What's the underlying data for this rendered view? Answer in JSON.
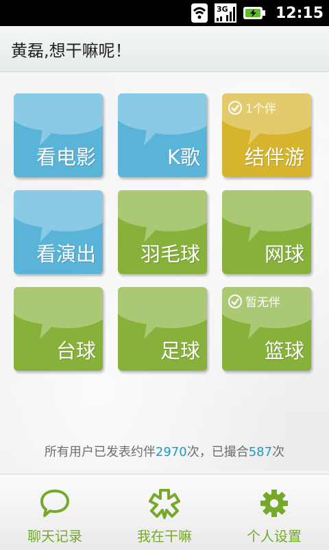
{
  "status_bar": {
    "network": "3G",
    "time": "12:15",
    "icons": [
      "signal-icon",
      "network-bars-icon",
      "battery-charging-icon"
    ]
  },
  "header": {
    "title": "黄磊,想干嘛呢！"
  },
  "tiles": [
    {
      "label": "看电影",
      "color": "#59b4d8",
      "badge": ""
    },
    {
      "label": "K歌",
      "color": "#59b4d8",
      "badge": ""
    },
    {
      "label": "结伴游",
      "color": "#d6b42e",
      "badge": "1个伴"
    },
    {
      "label": "看演出",
      "color": "#59b4d8",
      "badge": ""
    },
    {
      "label": "羽毛球",
      "color": "#87b13a",
      "badge": ""
    },
    {
      "label": "网球",
      "color": "#87b13a",
      "badge": ""
    },
    {
      "label": "台球",
      "color": "#87b13a",
      "badge": ""
    },
    {
      "label": "足球",
      "color": "#87b13a",
      "badge": ""
    },
    {
      "label": "篮球",
      "color": "#87b13a",
      "badge": "暂无伴"
    }
  ],
  "stats": {
    "prefix": "所有用户已发表约伴",
    "posts": "2970",
    "middle": "次，已撮合",
    "matches": "587",
    "suffix": "次"
  },
  "bottom_nav": [
    {
      "label": "聊天记录",
      "icon": "chat-bubble-icon"
    },
    {
      "label": "我在干嘛",
      "icon": "asterisk-flower-icon"
    },
    {
      "label": "个人设置",
      "icon": "gear-icon"
    }
  ],
  "colors": {
    "accent_green": "#75a92a",
    "stats_number": "#1b9bc4"
  }
}
